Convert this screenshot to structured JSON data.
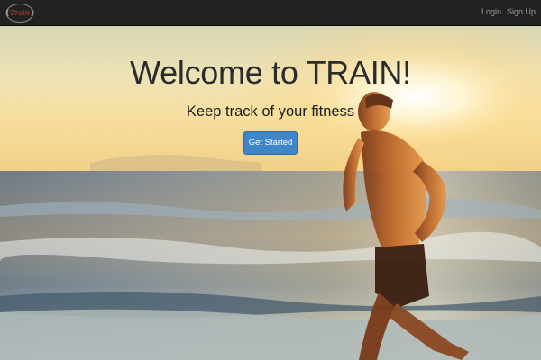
{
  "navbar": {
    "brand_logo_text": "Train",
    "login_label": "Login",
    "signup_label": "Sign Up"
  },
  "hero": {
    "headline": "Welcome to TRAIN!",
    "tagline": "Keep track of your fitness",
    "cta_label": "Get Started",
    "image_description_icon": "runner-on-beach-photo"
  },
  "colors": {
    "navbar_bg": "#222222",
    "nav_link": "#9d9d9d",
    "button_primary": "#3e86c8",
    "logo_red": "#c0392b"
  }
}
